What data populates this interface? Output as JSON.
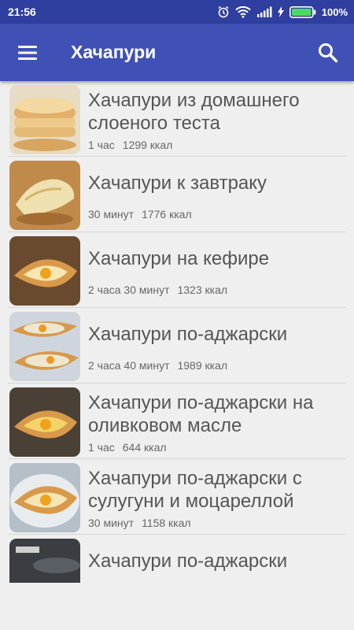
{
  "status": {
    "time": "21:56",
    "battery": "100%"
  },
  "appbar": {
    "title": "Хачапури"
  },
  "recipes": [
    {
      "title": "",
      "time": "",
      "kcal": "",
      "food": "brown"
    },
    {
      "title": "Хачапури из домашнего слоеного теста",
      "time": "1 час",
      "kcal": "1299 ккал",
      "food": "stack",
      "lines": 2
    },
    {
      "title": "Хачапури к завтраку",
      "time": "30 минут",
      "kcal": "1776 ккал",
      "food": "cheese",
      "lines": 1
    },
    {
      "title": "Хачапури на кефире",
      "time": "2 часа 30 минут",
      "kcal": "1323 ккал",
      "food": "boat",
      "lines": 1
    },
    {
      "title": "Хачапури по-аджарски",
      "time": "2 часа 40 минут",
      "kcal": "1989 ккал",
      "food": "boats",
      "lines": 1
    },
    {
      "title": "Хачапури по-аджарски на оливковом масле",
      "time": "1 час",
      "kcal": "644 ккал",
      "food": "boat-yellow",
      "lines": 2
    },
    {
      "title": "Хачапури по-аджарски с сулугуни и моцареллой",
      "time": "30 минут",
      "kcal": "1158 ккал",
      "food": "boat-plate",
      "lines": 2
    },
    {
      "title": "Хачапури по-аджарски",
      "time": "",
      "kcal": "",
      "food": "dark",
      "lines": 1
    }
  ],
  "icons": {
    "menu": "menu-icon",
    "search": "search-icon",
    "alarm": "alarm-icon",
    "wifi": "wifi-icon",
    "signal": "signal-icon",
    "battery": "battery-icon"
  },
  "colors": {
    "appbar": "#3f51b5",
    "statusbar": "#2f3f9f",
    "battery": "#4cd964"
  }
}
